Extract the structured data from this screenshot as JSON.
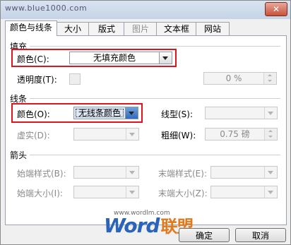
{
  "window": {
    "title": "www.blue1000.com",
    "close_label": "✕"
  },
  "tabs": [
    {
      "label": "颜色与线条"
    },
    {
      "label": "大小"
    },
    {
      "label": "版式"
    },
    {
      "label": "图片"
    },
    {
      "label": "文本框"
    },
    {
      "label": "网站"
    }
  ],
  "fill": {
    "section_label": "填充",
    "color_label": "颜色(C):",
    "color_value": "无填充颜色",
    "transparency_label": "透明度(T):",
    "transparency_value": "0 %"
  },
  "line": {
    "section_label": "线条",
    "color_label": "颜色(O):",
    "color_value": "无线条颜色",
    "style_label": "线型(S):",
    "dash_label": "虚实(D):",
    "weight_label": "粗细(W):",
    "weight_value": "0.75 磅"
  },
  "arrows": {
    "section_label": "箭头",
    "begin_style_label": "始端样式(B):",
    "end_style_label": "末端样式(E):",
    "begin_size_label": "始端大小(I):",
    "end_size_label": "末端大小(Z):"
  },
  "footer": {
    "ok_label": "确定",
    "cancel_label": "取消"
  },
  "watermark": {
    "url": "www.wordlm.com",
    "brand": "Word",
    "brand_cn": "联盟"
  },
  "colors": {
    "highlight": "#e0141e",
    "watermark_blue": "#2a64b8",
    "watermark_orange": "#e07a1c"
  }
}
